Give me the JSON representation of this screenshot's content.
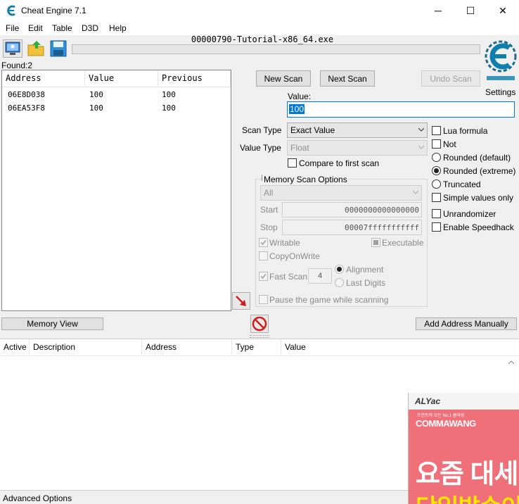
{
  "window": {
    "title": "Cheat Engine 7.1",
    "minimize_glyph": "─",
    "maximize_glyph": "☐",
    "close_glyph": "✕"
  },
  "menu": [
    "File",
    "Edit",
    "Table",
    "D3D",
    "Help"
  ],
  "process_name": "00000790-Tutorial-x86_64.exe",
  "found_label": "Found:2",
  "results": {
    "headers": [
      "Address",
      "Value",
      "Previous"
    ],
    "rows": [
      {
        "address": "06E8D038",
        "value": "100",
        "previous": "100"
      },
      {
        "address": "06EA53F8",
        "value": "100",
        "previous": "100"
      }
    ]
  },
  "scan": {
    "new_scan": "New Scan",
    "next_scan": "Next Scan",
    "undo_scan": "Undo Scan",
    "settings": "Settings",
    "value_label": "Value:",
    "value": "100",
    "scan_type_label": "Scan Type",
    "scan_type": "Exact Value",
    "value_type_label": "Value Type",
    "value_type": "Float",
    "compare_first": "Compare to first scan"
  },
  "memory_options": {
    "title": "Memory Scan Options",
    "region": "All",
    "start_label": "Start",
    "start": "0000000000000000",
    "stop_label": "Stop",
    "stop": "00007fffffffffff",
    "writable": "Writable",
    "executable": "Executable",
    "copyonwrite": "CopyOnWrite",
    "fast_scan": "Fast Scan",
    "fast_scan_value": "4",
    "alignment": "Alignment",
    "last_digits": "Last Digits",
    "pause_game": "Pause the game while scanning"
  },
  "right_options": {
    "lua_formula": "Lua formula",
    "not": "Not",
    "rounded_default": "Rounded (default)",
    "rounded_extreme": "Rounded (extreme)",
    "truncated": "Truncated",
    "simple_values": "Simple values only",
    "unrandomizer": "Unrandomizer",
    "speedhack": "Enable Speedhack"
  },
  "bottom": {
    "memory_view": "Memory View",
    "add_address": "Add Address Manually",
    "table_headers": [
      "Active",
      "Description",
      "Address",
      "Type",
      "Value"
    ],
    "advanced_options": "Advanced Options"
  },
  "ad": {
    "brand": "ALYac",
    "logo": "COMMAWANG",
    "tagline_small": "프린트의 모든 No.1 콤마왕",
    "line1": "요즘 대세",
    "line2": "당일발송이"
  },
  "colors": {
    "selection": "#0078d7",
    "ad_pink": "#f0707a",
    "ad_yellow": "#ffe600",
    "ce_logo": "#0e7fae"
  }
}
